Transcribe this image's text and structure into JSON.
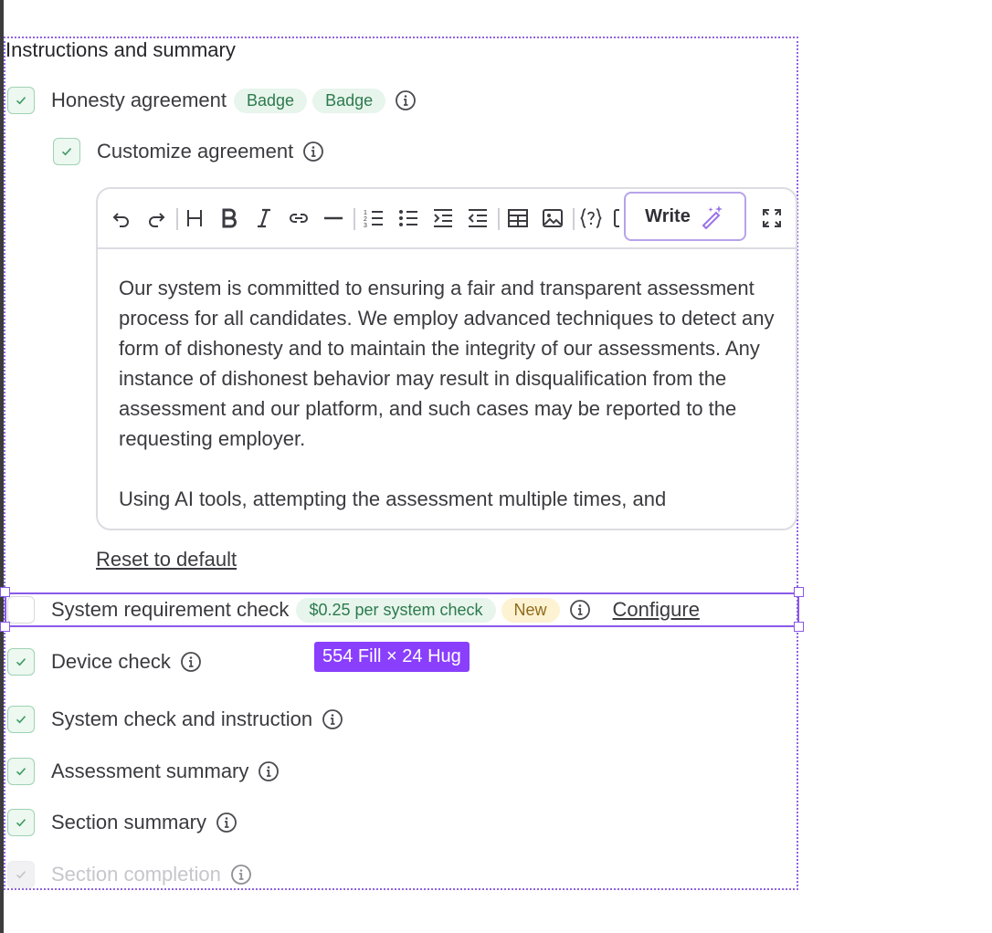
{
  "section_title": "Instructions and summary",
  "honesty": {
    "label": "Honesty agreement",
    "badges": [
      "Badge",
      "Badge"
    ],
    "checked": true
  },
  "customize": {
    "label": "Customize agreement",
    "checked": true
  },
  "editor": {
    "toolbar_icons": [
      "undo-icon",
      "redo-icon",
      "heading-icon",
      "bold-icon",
      "italic-icon",
      "link-icon",
      "horizontal-rule-icon",
      "ordered-list-icon",
      "bullet-list-icon",
      "indent-icon",
      "outdent-icon",
      "table-icon",
      "image-icon",
      "variable-icon",
      "copy-icon",
      "fullscreen-icon"
    ],
    "write_label": "Write",
    "paragraphs": [
      "Our system is committed to ensuring a fair and transparent assessment process for all candidates. We employ advanced techniques to detect any form of dishonesty and to maintain the integrity of our assessments. Any instance of dishonest behavior may result in disqualification from the assessment and our platform, and such cases may be reported to the requesting employer.",
      "Using AI tools, attempting the assessment multiple times, and"
    ]
  },
  "reset_label": "Reset to default",
  "system_requirement": {
    "label": "System requirement check",
    "price_badge": "$0.25 per system check",
    "new_badge": "New",
    "configure_label": "Configure",
    "checked": false
  },
  "dimension_label": "554 Fill × 24 Hug",
  "items": [
    {
      "label": "Device check",
      "checked": true
    },
    {
      "label": "System check and instruction",
      "checked": true
    },
    {
      "label": "Assessment summary",
      "checked": true
    },
    {
      "label": "Section summary",
      "checked": true
    },
    {
      "label": "Section completion",
      "checked": true,
      "disabled": true
    }
  ],
  "colors": {
    "accent": "#8a3ffc",
    "check_bg": "#ecf8f0",
    "check_border": "#9fd2b3",
    "badge_bg": "#e7f5ec",
    "badge_text": "#2d7a4d",
    "new_badge_bg": "#fdf3d2"
  }
}
